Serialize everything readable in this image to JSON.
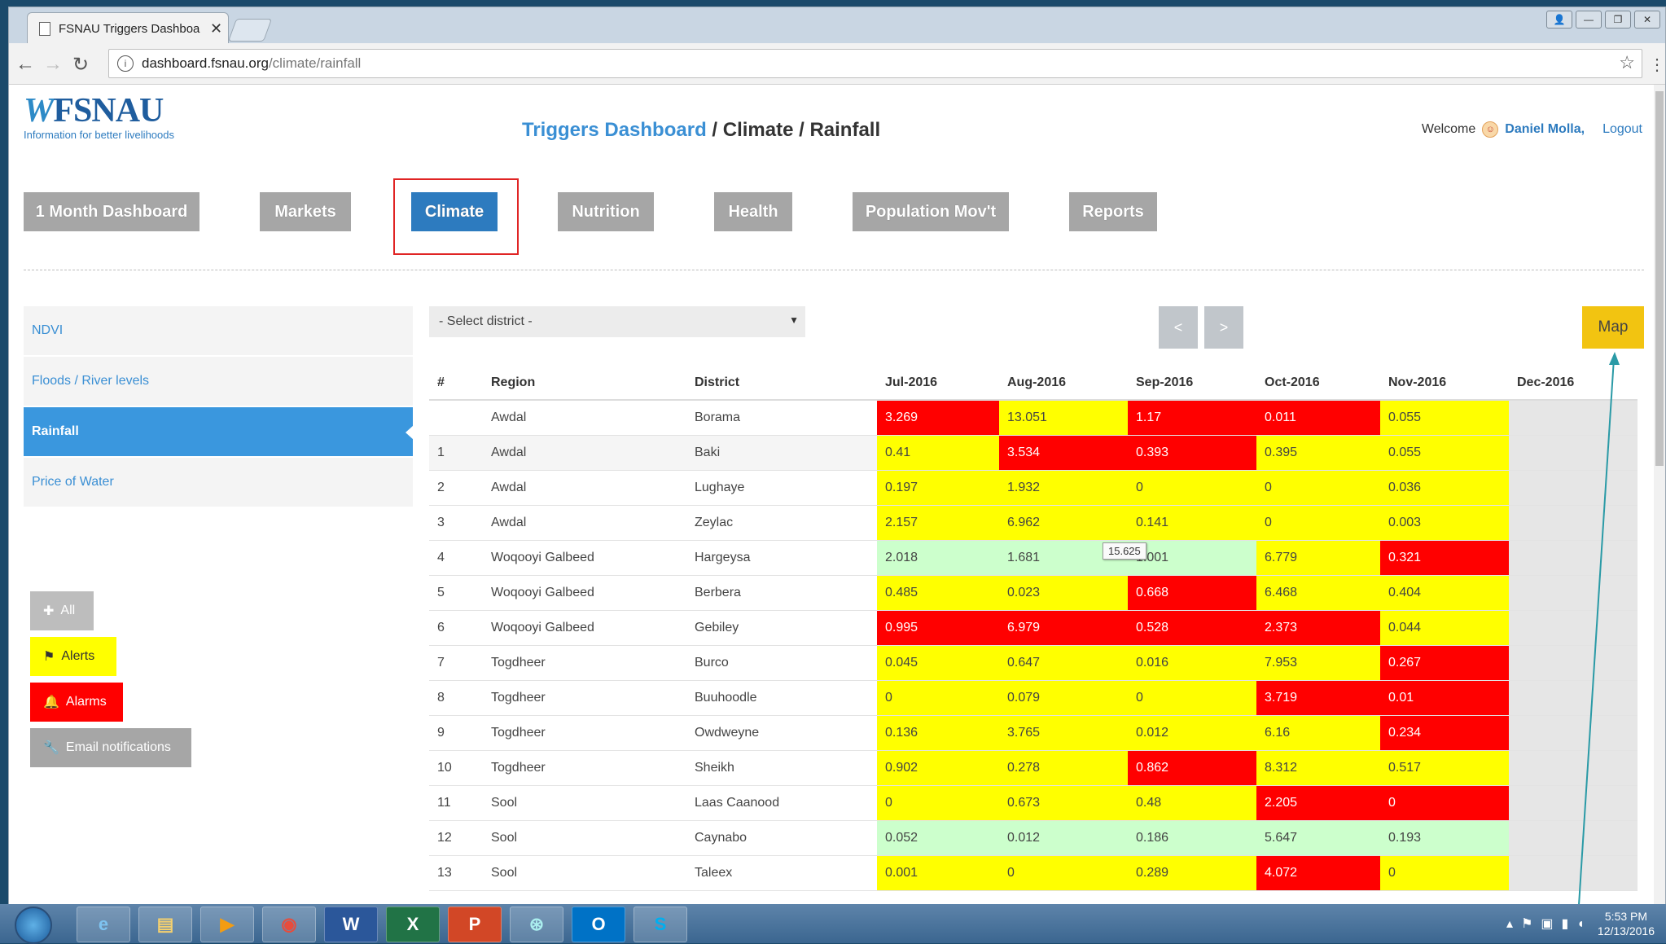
{
  "browser": {
    "tab_title": "FSNAU Triggers Dashboa",
    "url_host": "dashboard.fsnau.org",
    "url_path": "/climate/rainfall"
  },
  "header": {
    "logo_text": "FSNAU",
    "logo_tagline": "Information for better livelihoods",
    "breadcrumb_home": "Triggers Dashboard",
    "breadcrumb_rest": " / Climate / Rainfall",
    "welcome": "Welcome",
    "user": "Daniel Molla,",
    "logout": "Logout"
  },
  "nav": {
    "items": [
      "1 Month Dashboard",
      "Markets",
      "Climate",
      "Nutrition",
      "Health",
      "Population Mov't",
      "Reports"
    ],
    "active": "Climate"
  },
  "sidebar": {
    "items": [
      "NDVI",
      "Floods / River levels",
      "Rainfall",
      "Price of Water"
    ],
    "active": "Rainfall"
  },
  "filters": {
    "all": "All",
    "alerts": "Alerts",
    "alarms": "Alarms",
    "email": "Email notifications"
  },
  "controls": {
    "district_select": "- Select district -",
    "prev": "<",
    "next": ">",
    "map": "Map"
  },
  "table": {
    "headers": [
      "#",
      "Region",
      "District",
      "Jul-2016",
      "Aug-2016",
      "Sep-2016",
      "Oct-2016",
      "Nov-2016",
      "Dec-2016"
    ],
    "rows": [
      {
        "num": "",
        "region": "Awdal",
        "district": "Borama",
        "values": [
          "3.269",
          "13.051",
          "1.17",
          "0.011",
          "0.055",
          ""
        ],
        "levels": [
          "red",
          "yellow",
          "red",
          "red",
          "yellow",
          "grey"
        ]
      },
      {
        "num": "1",
        "region": "Awdal",
        "district": "Baki",
        "values": [
          "0.41",
          "3.534",
          "0.393",
          "0.395",
          "0.055",
          ""
        ],
        "levels": [
          "yellow",
          "red",
          "red",
          "yellow",
          "yellow",
          "grey"
        ]
      },
      {
        "num": "2",
        "region": "Awdal",
        "district": "Lughaye",
        "values": [
          "0.197",
          "1.932",
          "0",
          "0",
          "0.036",
          ""
        ],
        "levels": [
          "yellow",
          "yellow",
          "yellow",
          "yellow",
          "yellow",
          "grey"
        ]
      },
      {
        "num": "3",
        "region": "Awdal",
        "district": "Zeylac",
        "values": [
          "2.157",
          "6.962",
          "0.141",
          "0",
          "0.003",
          ""
        ],
        "levels": [
          "yellow",
          "yellow",
          "yellow",
          "yellow",
          "yellow",
          "grey"
        ]
      },
      {
        "num": "4",
        "region": "Woqooyi Galbeed",
        "district": "Hargeysa",
        "values": [
          "2.018",
          "1.681",
          "1.001",
          "6.779",
          "0.321",
          ""
        ],
        "levels": [
          "green",
          "green",
          "green",
          "yellow",
          "red",
          "grey"
        ]
      },
      {
        "num": "5",
        "region": "Woqooyi Galbeed",
        "district": "Berbera",
        "values": [
          "0.485",
          "0.023",
          "0.668",
          "6.468",
          "0.404",
          ""
        ],
        "levels": [
          "yellow",
          "yellow",
          "red",
          "yellow",
          "yellow",
          "grey"
        ]
      },
      {
        "num": "6",
        "region": "Woqooyi Galbeed",
        "district": "Gebiley",
        "values": [
          "0.995",
          "6.979",
          "0.528",
          "2.373",
          "0.044",
          ""
        ],
        "levels": [
          "red",
          "red",
          "red",
          "red",
          "yellow",
          "grey"
        ]
      },
      {
        "num": "7",
        "region": "Togdheer",
        "district": "Burco",
        "values": [
          "0.045",
          "0.647",
          "0.016",
          "7.953",
          "0.267",
          ""
        ],
        "levels": [
          "yellow",
          "yellow",
          "yellow",
          "yellow",
          "red",
          "grey"
        ]
      },
      {
        "num": "8",
        "region": "Togdheer",
        "district": "Buuhoodle",
        "values": [
          "0",
          "0.079",
          "0",
          "3.719",
          "0.01",
          ""
        ],
        "levels": [
          "yellow",
          "yellow",
          "yellow",
          "red",
          "red",
          "grey"
        ]
      },
      {
        "num": "9",
        "region": "Togdheer",
        "district": "Owdweyne",
        "values": [
          "0.136",
          "3.765",
          "0.012",
          "6.16",
          "0.234",
          ""
        ],
        "levels": [
          "yellow",
          "yellow",
          "yellow",
          "yellow",
          "red",
          "grey"
        ]
      },
      {
        "num": "10",
        "region": "Togdheer",
        "district": "Sheikh",
        "values": [
          "0.902",
          "0.278",
          "0.862",
          "8.312",
          "0.517",
          ""
        ],
        "levels": [
          "yellow",
          "yellow",
          "red",
          "yellow",
          "yellow",
          "grey"
        ]
      },
      {
        "num": "11",
        "region": "Sool",
        "district": "Laas Caanood",
        "values": [
          "0",
          "0.673",
          "0.48",
          "2.205",
          "0",
          ""
        ],
        "levels": [
          "yellow",
          "yellow",
          "yellow",
          "red",
          "red",
          "grey"
        ]
      },
      {
        "num": "12",
        "region": "Sool",
        "district": "Caynabo",
        "values": [
          "0.052",
          "0.012",
          "0.186",
          "5.647",
          "0.193",
          ""
        ],
        "levels": [
          "green",
          "green",
          "green",
          "green",
          "green",
          "grey"
        ]
      },
      {
        "num": "13",
        "region": "Sool",
        "district": "Taleex",
        "values": [
          "0.001",
          "0",
          "0.289",
          "4.072",
          "0",
          ""
        ],
        "levels": [
          "yellow",
          "yellow",
          "yellow",
          "red",
          "yellow",
          "grey"
        ]
      }
    ],
    "tooltip": "15.625"
  },
  "colors": {
    "red": "#ff0000",
    "yellow": "#ffff00",
    "green": "#ccffcc",
    "accent": "#2d7bbf",
    "map_button": "#f2c411",
    "annotation": "#2a9aa6"
  },
  "taskbar": {
    "apps": [
      "ie-icon",
      "explorer-icon",
      "media-player-icon",
      "chrome-icon",
      "word-icon",
      "excel-icon",
      "powerpoint-icon",
      "fao-icon",
      "outlook-icon",
      "skype-icon"
    ],
    "time": "5:53 PM",
    "date": "12/13/2016"
  }
}
